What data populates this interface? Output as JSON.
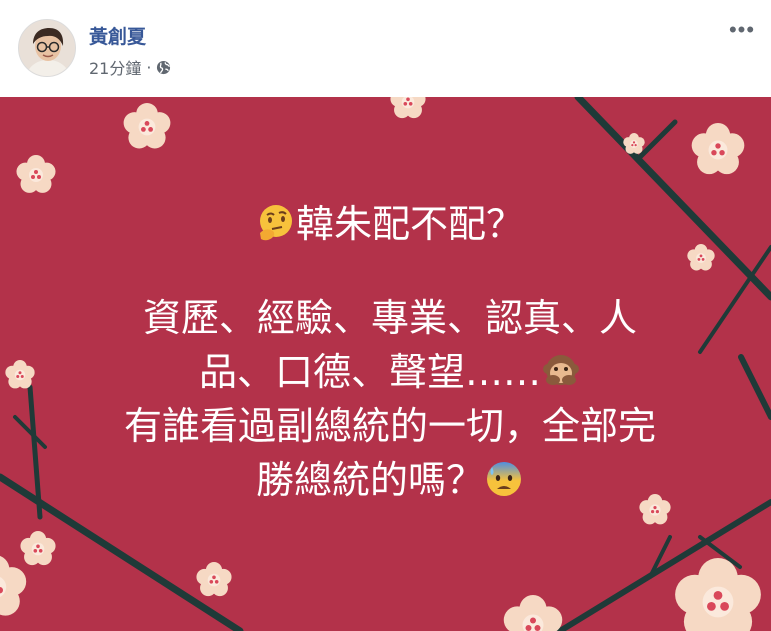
{
  "post": {
    "author": "黃創夏",
    "time": "21分鐘",
    "separator": "·",
    "privacy_icon": "globe-icon",
    "more_icon": "more-options-icon",
    "more_label": "•••"
  },
  "card": {
    "background_color": "#b3324a",
    "text_color": "#ffffff",
    "line1": "韓朱配不配？",
    "line2": "資歷、經驗、專業、認真、人",
    "line3": "品、口德、聲望……",
    "line4": "有誰看過副總統的一切，全部完",
    "line5": "勝總統的嗎？",
    "emoji_1": "thinking-face-icon",
    "emoji_2": "speak-no-evil-monkey-icon",
    "emoji_3": "anxious-face-with-sweat-icon"
  }
}
